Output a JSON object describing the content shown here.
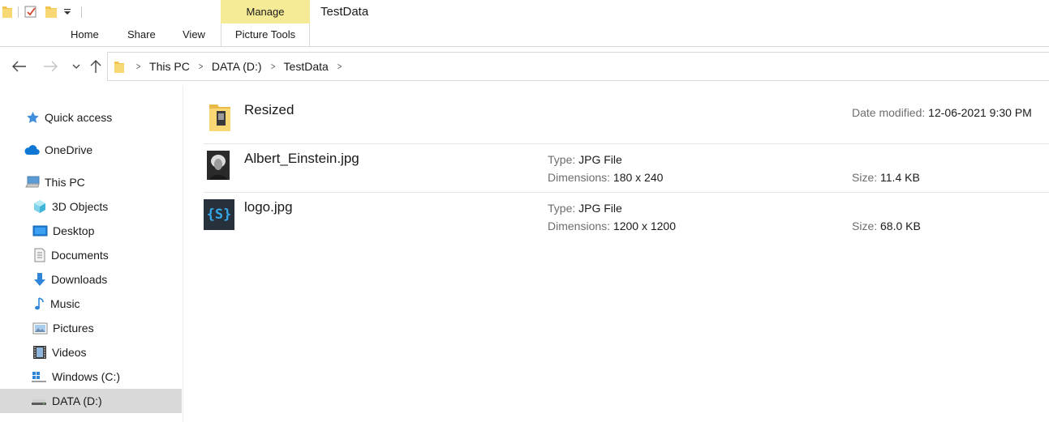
{
  "window": {
    "title": "TestData"
  },
  "ribbon": {
    "contextual_group": "Manage",
    "tabs": [
      "Home",
      "Share",
      "View",
      "Picture Tools"
    ]
  },
  "quick_access_toolbar": {
    "items": [
      "folder-icon",
      "properties-check-icon",
      "new-folder-icon",
      "customize-dropdown-icon"
    ]
  },
  "navigation": {
    "back": "←",
    "forward": "→",
    "recent": "⌄",
    "up": "↑",
    "breadcrumb": [
      "This PC",
      "DATA (D:)",
      "TestData"
    ]
  },
  "sidebar": {
    "items": [
      {
        "label": "Quick access",
        "icon": "star-icon"
      },
      {
        "label": "OneDrive",
        "icon": "cloud-icon"
      },
      {
        "label": "This PC",
        "icon": "computer-icon"
      },
      {
        "label": "3D Objects",
        "icon": "cube-icon"
      },
      {
        "label": "Desktop",
        "icon": "desktop-icon"
      },
      {
        "label": "Documents",
        "icon": "document-icon"
      },
      {
        "label": "Downloads",
        "icon": "download-icon"
      },
      {
        "label": "Music",
        "icon": "music-icon"
      },
      {
        "label": "Pictures",
        "icon": "pictures-icon"
      },
      {
        "label": "Videos",
        "icon": "videos-icon"
      },
      {
        "label": "Windows (C:)",
        "icon": "windows-drive-icon"
      },
      {
        "label": "DATA (D:)",
        "icon": "drive-icon",
        "selected": true
      }
    ]
  },
  "files": [
    {
      "name": "Resized",
      "kind": "folder",
      "date_label": "Date modified:",
      "date_value": "12-06-2021 9:30 PM"
    },
    {
      "name": "Albert_Einstein.jpg",
      "type_label": "Type:",
      "type_value": "JPG File",
      "dim_label": "Dimensions:",
      "dim_value": "180 x 240",
      "size_label": "Size:",
      "size_value": "11.4 KB"
    },
    {
      "name": "logo.jpg",
      "type_label": "Type:",
      "type_value": "JPG File",
      "dim_label": "Dimensions:",
      "dim_value": "1200 x 1200",
      "size_label": "Size:",
      "size_value": "68.0 KB",
      "thumb_text": "{S}"
    }
  ],
  "colors": {
    "manage_tab": "#f5eb96",
    "selection": "#d9d9d9",
    "folder_yellow": "#f8d775",
    "onedrive_blue": "#0f78d4",
    "logo_bg": "#27313c",
    "logo_blue": "#35a6e8"
  }
}
